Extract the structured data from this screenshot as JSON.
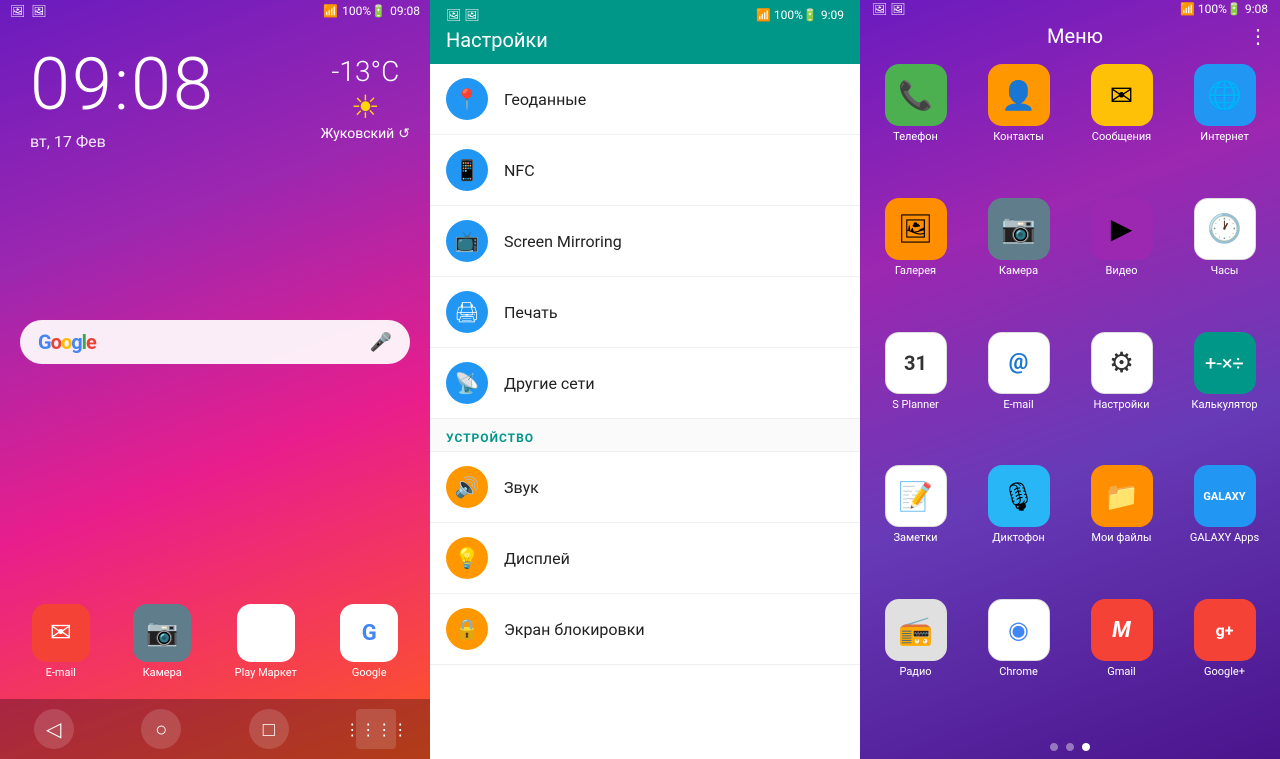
{
  "lockscreen": {
    "time": "09:08",
    "date": "вт, 17 Фев",
    "temperature": "-13°C",
    "city": "Жуковский",
    "status_left": [
      "📶",
      "🔋 100%"
    ],
    "status_right": "9:08",
    "google_label": "Google",
    "search_placeholder": "Google",
    "dock": [
      {
        "label": "E-mail",
        "icon": "✉",
        "bg": "bg-email"
      },
      {
        "label": "Камера",
        "icon": "📷",
        "bg": "bg-grey"
      },
      {
        "label": "Play Маркет",
        "icon": "▶",
        "bg": "bg-playstore"
      },
      {
        "label": "Google",
        "icon": "G",
        "bg": "bg-google-maps"
      }
    ],
    "bottom_nav": [
      "◁",
      "○",
      "□"
    ]
  },
  "settings": {
    "title": "Настройки",
    "time": "9:09",
    "items_connection": [
      {
        "label": "Геоданные",
        "icon": "📍",
        "color": "blue"
      },
      {
        "label": "NFC",
        "icon": "📱",
        "color": "blue"
      },
      {
        "label": "Screen Mirroring",
        "icon": "📺",
        "color": "blue"
      },
      {
        "label": "Печать",
        "icon": "🖨",
        "color": "blue"
      },
      {
        "label": "Другие сети",
        "icon": "📡",
        "color": "blue"
      }
    ],
    "section_device": "УСТРОЙСТВО",
    "items_device": [
      {
        "label": "Звук",
        "icon": "🔊",
        "color": "orange"
      },
      {
        "label": "Дисплей",
        "icon": "💡",
        "color": "orange"
      },
      {
        "label": "Экран блокировки",
        "icon": "🔒",
        "color": "orange"
      }
    ]
  },
  "menu": {
    "title": "Меню",
    "time": "9:08",
    "apps": [
      {
        "label": "Телефон",
        "icon": "📞",
        "bg": "bg-green"
      },
      {
        "label": "Контакты",
        "icon": "👤",
        "bg": "bg-orange"
      },
      {
        "label": "Сообщения",
        "icon": "✉",
        "bg": "bg-yellow"
      },
      {
        "label": "Интернет",
        "icon": "🌐",
        "bg": "bg-blue"
      },
      {
        "label": "Галерея",
        "icon": "🖼",
        "bg": "bg-amber"
      },
      {
        "label": "Камера",
        "icon": "📷",
        "bg": "bg-grey"
      },
      {
        "label": "Видео",
        "icon": "▶",
        "bg": "bg-purple"
      },
      {
        "label": "Часы",
        "icon": "🕐",
        "bg": "bg-white"
      },
      {
        "label": "S Planner",
        "icon": "31",
        "bg": "bg-white"
      },
      {
        "label": "E-mail",
        "icon": "@",
        "bg": "bg-white"
      },
      {
        "label": "Настройки",
        "icon": "⚙",
        "bg": "bg-white"
      },
      {
        "label": "Калькулятор",
        "icon": "#",
        "bg": "bg-teal"
      },
      {
        "label": "Заметки",
        "icon": "📝",
        "bg": "bg-white"
      },
      {
        "label": "Диктофон",
        "icon": "🎙",
        "bg": "bg-lightblue"
      },
      {
        "label": "Мои файлы",
        "icon": "📁",
        "bg": "bg-amber"
      },
      {
        "label": "GALAXY Apps",
        "icon": "G",
        "bg": "bg-blue"
      },
      {
        "label": "Радио",
        "icon": "📻",
        "bg": "bg-white"
      },
      {
        "label": "Chrome",
        "icon": "◉",
        "bg": "bg-white"
      },
      {
        "label": "Gmail",
        "icon": "M",
        "bg": "bg-red"
      },
      {
        "label": "Google+",
        "icon": "g+",
        "bg": "bg-red"
      }
    ],
    "dots": [
      false,
      false,
      true
    ],
    "more_icon": "⋮"
  }
}
